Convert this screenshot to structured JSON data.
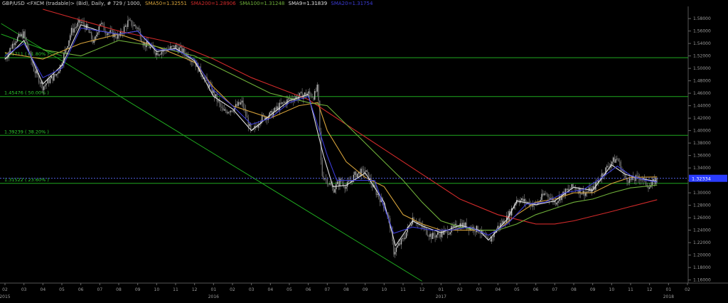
{
  "header": {
    "title": "GBP/USD <FXCM (tradable)> (Bid), Daily, # 729 / 1000,",
    "indicators": [
      {
        "label": "SMA50=1.32551",
        "color": "#d6a23a"
      },
      {
        "label": "SMA200=1.28906",
        "color": "#d12a2a"
      },
      {
        "label": "SMA100=1.31248",
        "color": "#6fb03a"
      },
      {
        "label": "SMA9=1.31839",
        "color": "#e0e0e0"
      },
      {
        "label": "SMA20=1.31754",
        "color": "#3b3bd6"
      }
    ]
  },
  "chart_data": {
    "type": "line",
    "title": "GBP/USD <FXCM (tradable)> (Bid), Daily",
    "ylim": [
      1.155,
      1.595
    ],
    "y_ticks": [
      "1.58000",
      "1.56000",
      "1.54000",
      "1.52000",
      "1.50000",
      "1.48000",
      "1.46000",
      "1.44000",
      "1.42000",
      "1.40000",
      "1.38000",
      "1.36000",
      "1.34000",
      "1.32000",
      "1.30000",
      "1.28000",
      "1.26000",
      "1.24000",
      "1.22000",
      "1.20000",
      "1.18000",
      "1.16000"
    ],
    "y_tick_values": [
      1.58,
      1.56,
      1.54,
      1.52,
      1.5,
      1.48,
      1.46,
      1.44,
      1.42,
      1.4,
      1.38,
      1.36,
      1.34,
      1.32,
      1.3,
      1.28,
      1.26,
      1.24,
      1.22,
      1.2,
      1.18,
      1.16
    ],
    "x_ticks": [
      "02",
      "03",
      "04",
      "05",
      "06",
      "07",
      "08",
      "09",
      "10",
      "11",
      "12",
      "01",
      "02",
      "03",
      "04",
      "05",
      "06",
      "07",
      "08",
      "09",
      "10",
      "11",
      "12",
      "01",
      "02",
      "03",
      "04",
      "05",
      "06",
      "07",
      "08",
      "09",
      "10",
      "11",
      "12",
      "01",
      "02"
    ],
    "x_tick_t": [
      0.0,
      1.0,
      2.0,
      3.0,
      4.0,
      5.0,
      6.0,
      7.0,
      8.0,
      9.0,
      10.0,
      11.0,
      12.0,
      13.0,
      14.0,
      15.0,
      16.0,
      17.0,
      18.0,
      19.0,
      20.0,
      21.0,
      22.0,
      23.0,
      24.0,
      25.0,
      26.0,
      27.0,
      28.0,
      29.0,
      30.0,
      31.0,
      32.0,
      33.0,
      34.0,
      35.0,
      36.0
    ],
    "year_labels": [
      {
        "label": "2015",
        "t": 0.0
      },
      {
        "label": "2016",
        "t": 11.0
      },
      {
        "label": "2017",
        "t": 23.0
      },
      {
        "label": "2018",
        "t": 35.0
      }
    ],
    "current_price": "1.32334",
    "current_value": 1.32334,
    "fib_levels": [
      {
        "label": "1.51711 ( 61.80% )",
        "value": 1.51711
      },
      {
        "label": "1.45476 ( 50.00% )",
        "value": 1.45476
      },
      {
        "label": "1.39239 ( 38.20% )",
        "value": 1.39239
      },
      {
        "label": "1.31522 ( 23.60% )",
        "value": 1.31522
      }
    ],
    "trendlines": [
      {
        "from": {
          "t": -0.2,
          "v": 1.572
        },
        "to": {
          "t": 22.0,
          "v": 1.158
        }
      },
      {
        "from": {
          "t": -0.2,
          "v": 1.555
        },
        "to": {
          "t": 3.0,
          "v": 1.52
        }
      }
    ],
    "price_path": [
      [
        0.0,
        1.515
      ],
      [
        0.5,
        1.545
      ],
      [
        1.0,
        1.555
      ],
      [
        1.5,
        1.5
      ],
      [
        2.0,
        1.47
      ],
      [
        2.3,
        1.48
      ],
      [
        2.7,
        1.49
      ],
      [
        3.0,
        1.51
      ],
      [
        3.5,
        1.56
      ],
      [
        4.0,
        1.575
      ],
      [
        4.3,
        1.565
      ],
      [
        4.7,
        1.54
      ],
      [
        5.0,
        1.575
      ],
      [
        5.3,
        1.56
      ],
      [
        5.7,
        1.555
      ],
      [
        6.0,
        1.55
      ],
      [
        6.5,
        1.575
      ],
      [
        7.0,
        1.565
      ],
      [
        7.3,
        1.54
      ],
      [
        7.6,
        1.535
      ],
      [
        8.0,
        1.525
      ],
      [
        8.5,
        1.53
      ],
      [
        9.0,
        1.535
      ],
      [
        9.5,
        1.525
      ],
      [
        10.0,
        1.51
      ],
      [
        10.4,
        1.49
      ],
      [
        11.0,
        1.46
      ],
      [
        11.5,
        1.43
      ],
      [
        12.0,
        1.435
      ],
      [
        12.5,
        1.445
      ],
      [
        13.0,
        1.395
      ],
      [
        13.5,
        1.42
      ],
      [
        14.0,
        1.425
      ],
      [
        14.5,
        1.44
      ],
      [
        15.0,
        1.45
      ],
      [
        15.5,
        1.455
      ],
      [
        16.0,
        1.46
      ],
      [
        16.3,
        1.455
      ],
      [
        16.5,
        1.47
      ],
      [
        16.7,
        1.33
      ],
      [
        17.0,
        1.32
      ],
      [
        17.3,
        1.305
      ],
      [
        17.7,
        1.32
      ],
      [
        18.0,
        1.31
      ],
      [
        18.5,
        1.33
      ],
      [
        19.0,
        1.335
      ],
      [
        19.5,
        1.305
      ],
      [
        20.0,
        1.28
      ],
      [
        20.3,
        1.25
      ],
      [
        20.5,
        1.205
      ],
      [
        21.0,
        1.225
      ],
      [
        21.5,
        1.26
      ],
      [
        22.0,
        1.245
      ],
      [
        22.5,
        1.23
      ],
      [
        23.0,
        1.235
      ],
      [
        23.5,
        1.24
      ],
      [
        24.0,
        1.25
      ],
      [
        24.5,
        1.245
      ],
      [
        25.0,
        1.24
      ],
      [
        25.5,
        1.22
      ],
      [
        26.0,
        1.245
      ],
      [
        26.5,
        1.26
      ],
      [
        27.0,
        1.29
      ],
      [
        27.5,
        1.285
      ],
      [
        28.0,
        1.28
      ],
      [
        28.5,
        1.3
      ],
      [
        29.0,
        1.285
      ],
      [
        29.5,
        1.3
      ],
      [
        30.0,
        1.31
      ],
      [
        30.5,
        1.3
      ],
      [
        31.0,
        1.305
      ],
      [
        31.5,
        1.33
      ],
      [
        32.0,
        1.35
      ],
      [
        32.3,
        1.355
      ],
      [
        32.7,
        1.325
      ],
      [
        33.0,
        1.32
      ],
      [
        33.5,
        1.325
      ],
      [
        34.0,
        1.31
      ],
      [
        34.4,
        1.323
      ]
    ],
    "series": [
      {
        "name": "SMA50",
        "color": "#d6a23a",
        "values": [
          [
            0.0,
            1.525
          ],
          [
            2.0,
            1.515
          ],
          [
            4.0,
            1.54
          ],
          [
            6.0,
            1.555
          ],
          [
            8.0,
            1.535
          ],
          [
            10.0,
            1.51
          ],
          [
            11.0,
            1.47
          ],
          [
            12.0,
            1.44
          ],
          [
            14.0,
            1.42
          ],
          [
            15.5,
            1.44
          ],
          [
            16.5,
            1.445
          ],
          [
            17.0,
            1.4
          ],
          [
            18.0,
            1.35
          ],
          [
            19.0,
            1.325
          ],
          [
            20.0,
            1.31
          ],
          [
            21.0,
            1.265
          ],
          [
            22.0,
            1.25
          ],
          [
            23.0,
            1.24
          ],
          [
            24.0,
            1.24
          ],
          [
            25.0,
            1.24
          ],
          [
            26.0,
            1.24
          ],
          [
            27.0,
            1.265
          ],
          [
            28.0,
            1.285
          ],
          [
            29.0,
            1.29
          ],
          [
            30.0,
            1.3
          ],
          [
            31.0,
            1.3
          ],
          [
            32.0,
            1.315
          ],
          [
            33.0,
            1.325
          ],
          [
            34.4,
            1.3255
          ]
        ]
      },
      {
        "name": "SMA200",
        "color": "#d12a2a",
        "values": [
          [
            2.0,
            1.595
          ],
          [
            6.0,
            1.56
          ],
          [
            9.0,
            1.54
          ],
          [
            11.0,
            1.515
          ],
          [
            13.0,
            1.485
          ],
          [
            16.0,
            1.45
          ],
          [
            18.0,
            1.41
          ],
          [
            20.0,
            1.37
          ],
          [
            22.0,
            1.33
          ],
          [
            24.0,
            1.29
          ],
          [
            26.0,
            1.265
          ],
          [
            28.0,
            1.25
          ],
          [
            29.0,
            1.25
          ],
          [
            30.0,
            1.255
          ],
          [
            32.0,
            1.27
          ],
          [
            33.0,
            1.278
          ],
          [
            34.4,
            1.289
          ]
        ]
      },
      {
        "name": "SMA100",
        "color": "#6fb03a",
        "values": [
          [
            2.0,
            1.53
          ],
          [
            4.0,
            1.52
          ],
          [
            6.0,
            1.545
          ],
          [
            8.0,
            1.535
          ],
          [
            10.0,
            1.52
          ],
          [
            12.0,
            1.49
          ],
          [
            14.0,
            1.46
          ],
          [
            16.0,
            1.445
          ],
          [
            17.0,
            1.44
          ],
          [
            18.0,
            1.41
          ],
          [
            19.0,
            1.38
          ],
          [
            20.0,
            1.35
          ],
          [
            21.0,
            1.32
          ],
          [
            22.0,
            1.285
          ],
          [
            23.0,
            1.255
          ],
          [
            24.0,
            1.245
          ],
          [
            25.0,
            1.24
          ],
          [
            26.0,
            1.24
          ],
          [
            27.0,
            1.25
          ],
          [
            28.0,
            1.265
          ],
          [
            29.0,
            1.275
          ],
          [
            30.0,
            1.285
          ],
          [
            31.0,
            1.29
          ],
          [
            32.0,
            1.3
          ],
          [
            33.0,
            1.308
          ],
          [
            34.4,
            1.3125
          ]
        ]
      },
      {
        "name": "SMA9",
        "color": "#e0e0e0",
        "values": [
          [
            0.0,
            1.515
          ],
          [
            1.0,
            1.545
          ],
          [
            2.0,
            1.475
          ],
          [
            3.0,
            1.505
          ],
          [
            4.0,
            1.57
          ],
          [
            5.0,
            1.56
          ],
          [
            6.0,
            1.555
          ],
          [
            7.0,
            1.56
          ],
          [
            8.0,
            1.527
          ],
          [
            9.0,
            1.532
          ],
          [
            10.0,
            1.512
          ],
          [
            11.0,
            1.455
          ],
          [
            12.0,
            1.435
          ],
          [
            13.0,
            1.4
          ],
          [
            14.0,
            1.425
          ],
          [
            15.0,
            1.448
          ],
          [
            16.0,
            1.458
          ],
          [
            16.8,
            1.36
          ],
          [
            17.3,
            1.31
          ],
          [
            18.0,
            1.312
          ],
          [
            19.0,
            1.332
          ],
          [
            20.0,
            1.285
          ],
          [
            20.6,
            1.215
          ],
          [
            21.5,
            1.255
          ],
          [
            22.0,
            1.247
          ],
          [
            23.0,
            1.236
          ],
          [
            24.0,
            1.248
          ],
          [
            25.0,
            1.24
          ],
          [
            25.5,
            1.224
          ],
          [
            26.5,
            1.258
          ],
          [
            27.0,
            1.287
          ],
          [
            28.0,
            1.281
          ],
          [
            29.0,
            1.287
          ],
          [
            30.0,
            1.309
          ],
          [
            31.0,
            1.304
          ],
          [
            32.0,
            1.345
          ],
          [
            32.7,
            1.33
          ],
          [
            33.5,
            1.323
          ],
          [
            34.4,
            1.3184
          ]
        ]
      },
      {
        "name": "SMA20",
        "color": "#3b3bd6",
        "values": [
          [
            0.0,
            1.52
          ],
          [
            1.0,
            1.54
          ],
          [
            2.0,
            1.485
          ],
          [
            3.0,
            1.5
          ],
          [
            4.0,
            1.565
          ],
          [
            5.0,
            1.56
          ],
          [
            6.0,
            1.555
          ],
          [
            7.0,
            1.56
          ],
          [
            8.0,
            1.53
          ],
          [
            9.0,
            1.53
          ],
          [
            10.0,
            1.515
          ],
          [
            11.0,
            1.465
          ],
          [
            12.0,
            1.44
          ],
          [
            13.0,
            1.41
          ],
          [
            14.0,
            1.42
          ],
          [
            15.0,
            1.445
          ],
          [
            16.0,
            1.455
          ],
          [
            17.0,
            1.36
          ],
          [
            17.5,
            1.32
          ],
          [
            18.5,
            1.32
          ],
          [
            19.5,
            1.32
          ],
          [
            20.5,
            1.235
          ],
          [
            21.5,
            1.245
          ],
          [
            22.5,
            1.24
          ],
          [
            23.5,
            1.24
          ],
          [
            24.5,
            1.245
          ],
          [
            25.5,
            1.232
          ],
          [
            26.5,
            1.25
          ],
          [
            27.5,
            1.282
          ],
          [
            28.5,
            1.285
          ],
          [
            29.5,
            1.3
          ],
          [
            30.5,
            1.305
          ],
          [
            31.5,
            1.325
          ],
          [
            32.3,
            1.343
          ],
          [
            33.0,
            1.328
          ],
          [
            33.8,
            1.32
          ],
          [
            34.4,
            1.3175
          ]
        ]
      }
    ]
  }
}
